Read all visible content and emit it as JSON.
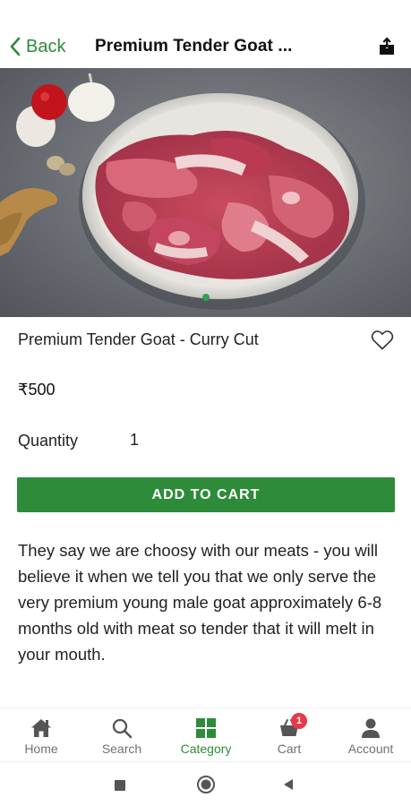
{
  "header": {
    "back_label": "Back",
    "title": "Premium Tender Goat ...",
    "accent_color": "#2e8b3a"
  },
  "carousel": {
    "image_subject": "goat curry cut meat in white bowl with garlic, tomato and ginger",
    "active_index": 1,
    "total": 1
  },
  "product": {
    "name": "Premium Tender Goat - Curry Cut",
    "price": "₹500",
    "quantity_label": "Quantity",
    "quantity_value": "1",
    "add_to_cart_label": "ADD TO CART",
    "description": "They say we are choosy with our meats - you will believe it when we tell you that we only serve the very premium young male goat approximately 6-8 months old with meat so tender that it will melt in your mouth."
  },
  "bottom_nav": {
    "items": [
      {
        "label": "Home",
        "icon": "home-icon"
      },
      {
        "label": "Search",
        "icon": "search-icon"
      },
      {
        "label": "Category",
        "icon": "grid-icon",
        "active": true
      },
      {
        "label": "Cart",
        "icon": "cart-icon",
        "badge": "1"
      },
      {
        "label": "Account",
        "icon": "person-icon"
      }
    ]
  },
  "system_nav": {
    "icons": [
      "recents-icon",
      "home-circle-icon",
      "back-triangle-icon"
    ]
  }
}
